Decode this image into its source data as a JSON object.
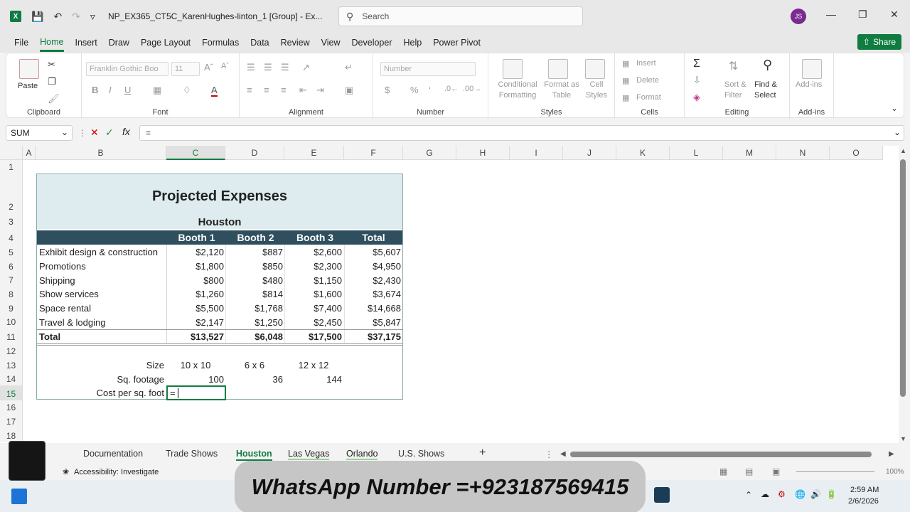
{
  "titlebar": {
    "doc_title": "NP_EX365_CT5C_KarenHughes-linton_1  [Group]  - Ex...",
    "search_placeholder": "Search",
    "avatar_initials": "JS"
  },
  "menu": [
    "File",
    "Home",
    "Insert",
    "Draw",
    "Page Layout",
    "Formulas",
    "Data",
    "Review",
    "View",
    "Developer",
    "Help",
    "Power Pivot"
  ],
  "menu_active": "Home",
  "share_label": "Share",
  "ribbon": {
    "paste": "Paste",
    "font_name": "Franklin Gothic Boo",
    "font_size": "11",
    "number_format": "Number",
    "cond_format": "Conditional",
    "cond_format2": "Formatting",
    "format_table": "Format as",
    "format_table2": "Table",
    "cell_styles": "Cell",
    "cell_styles2": "Styles",
    "insert": "Insert",
    "delete": "Delete",
    "format": "Format",
    "sort": "Sort &",
    "sort2": "Filter",
    "find": "Find &",
    "find2": "Select",
    "addins": "Add-ins",
    "groups": {
      "clipboard": "Clipboard",
      "font": "Font",
      "alignment": "Alignment",
      "number": "Number",
      "styles": "Styles",
      "cells": "Cells",
      "editing": "Editing",
      "addins": "Add-ins"
    }
  },
  "formula_bar": {
    "name_box": "SUM",
    "formula": "="
  },
  "columns": [
    "A",
    "B",
    "C",
    "D",
    "E",
    "F",
    "G",
    "H",
    "I",
    "J",
    "K",
    "L",
    "M",
    "N",
    "O"
  ],
  "rows": [
    "1",
    "2",
    "3",
    "4",
    "5",
    "6",
    "7",
    "8",
    "9",
    "10",
    "11",
    "12",
    "13",
    "14",
    "15",
    "16",
    "17",
    "18"
  ],
  "sheet": {
    "title": "Projected Expenses",
    "subtitle": "Houston",
    "headers": [
      "Booth 1",
      "Booth 2",
      "Booth 3",
      "Total"
    ],
    "data_rows": [
      {
        "label": "Exhibit design & construction",
        "values": [
          "$2,120",
          "$887",
          "$2,600",
          "$5,607"
        ]
      },
      {
        "label": "Promotions",
        "values": [
          "$1,800",
          "$850",
          "$2,300",
          "$4,950"
        ]
      },
      {
        "label": "Shipping",
        "values": [
          "$800",
          "$480",
          "$1,150",
          "$2,430"
        ]
      },
      {
        "label": "Show services",
        "values": [
          "$1,260",
          "$814",
          "$1,600",
          "$3,674"
        ]
      },
      {
        "label": "Space rental",
        "values": [
          "$5,500",
          "$1,768",
          "$7,400",
          "$14,668"
        ]
      },
      {
        "label": "Travel & lodging",
        "values": [
          "$2,147",
          "$1,250",
          "$2,450",
          "$5,847"
        ]
      }
    ],
    "total": {
      "label": "Total",
      "values": [
        "$13,527",
        "$6,048",
        "$17,500",
        "$37,175"
      ]
    },
    "size": {
      "label": "Size",
      "values": [
        "10 x 10",
        "6 x 6",
        "12 x 12"
      ]
    },
    "sqft": {
      "label": "Sq. footage",
      "values": [
        "100",
        "36",
        "144"
      ]
    },
    "cost": {
      "label": "Cost per sq. foot",
      "value": "="
    }
  },
  "tabs": [
    "Documentation",
    "Trade Shows",
    "Houston",
    "Las Vegas",
    "Orlando",
    "U.S. Shows"
  ],
  "tab_active": "Houston",
  "status": {
    "accessibility": "Accessibility: Investigate",
    "zoom": "100%"
  },
  "overlay": {
    "whatsapp": "WhatsApp Number =+923187569415"
  },
  "taskbar": {
    "time": "2:59 AM",
    "date": "2/6/2026"
  }
}
